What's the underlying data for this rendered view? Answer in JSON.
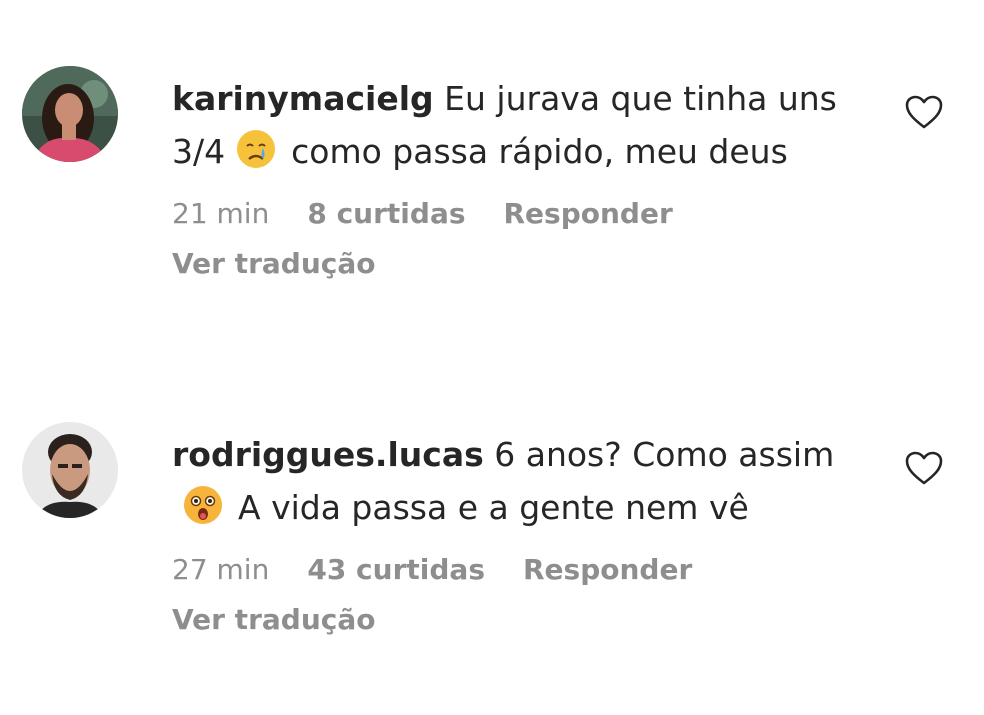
{
  "comments": [
    {
      "username": "karinymacielg",
      "text_before_emoji": "Eu jurava que tinha uns 3/4",
      "emoji": "crying-face-emoji",
      "text_after_emoji": "como passa rápido, meu deus",
      "time": "21 min",
      "likes": "8 curtidas",
      "reply_label": "Responder",
      "translate_label": "Ver tradução"
    },
    {
      "username": "rodriggues.lucas",
      "text_before_emoji": "6 anos? Como assim",
      "emoji": "astonished-face-emoji",
      "text_after_emoji": "A vida passa e a gente nem vê",
      "time": "27 min",
      "likes": "43 curtidas",
      "reply_label": "Responder",
      "translate_label": "Ver tradução"
    }
  ],
  "colors": {
    "text": "#262626",
    "muted": "#8e8e8e",
    "background": "#ffffff"
  }
}
